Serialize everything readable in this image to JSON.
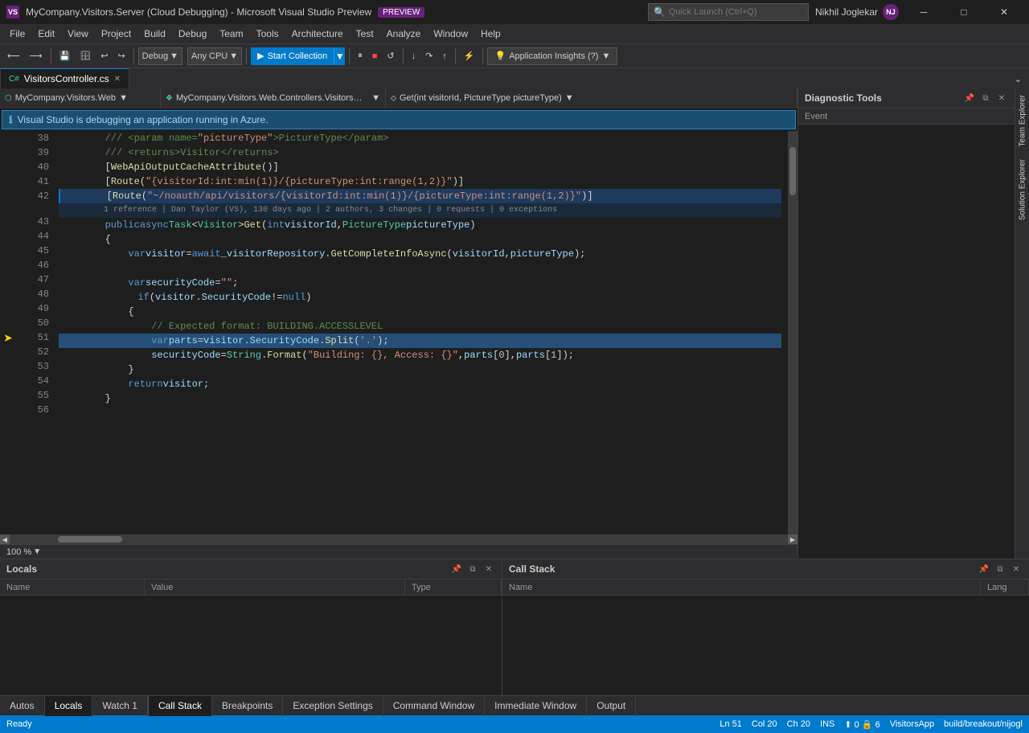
{
  "titleBar": {
    "title": "MyCompany.Visitors.Server (Cloud Debugging) - Microsoft Visual Studio Preview",
    "previewLabel": "PREVIEW",
    "searchPlaceholder": "Quick Launch (Ctrl+Q)",
    "user": "Nikhil Joglekar",
    "userInitials": "NJ"
  },
  "menuBar": {
    "items": [
      "File",
      "Edit",
      "View",
      "Project",
      "Build",
      "Debug",
      "Team",
      "Tools",
      "Architecture",
      "Test",
      "Analyze",
      "Window",
      "Help"
    ]
  },
  "toolbar": {
    "debugConfig": "Debug",
    "platform": "Any CPU",
    "startCollection": "Start Collection",
    "aiLabel": "Application Insights (?) "
  },
  "tabs": {
    "active": "VisitorsController.cs",
    "items": [
      {
        "label": "VisitorsController.cs",
        "active": true
      }
    ]
  },
  "navBar": {
    "project": "MyCompany.Visitors.Web",
    "class": "MyCompany.Visitors.Web.Controllers.VisitorsContr...",
    "method": "Get(int visitorId, PictureType pictureType)"
  },
  "infoBar": {
    "message": "Visual Studio is debugging an application running in Azure."
  },
  "code": {
    "lines": [
      {
        "num": 38,
        "content": "        /// <param name=\"pictureType\">PictureType</param>",
        "type": "normal"
      },
      {
        "num": 39,
        "content": "        /// <returns>Visitor</returns>",
        "type": "normal"
      },
      {
        "num": 40,
        "content": "        [WebApiOutputCacheAttribute()]",
        "type": "normal"
      },
      {
        "num": 41,
        "content": "        [Route(\"{visitorId:int:min(1)}/{pictureType:int:range(1,2)}\")]",
        "type": "normal"
      },
      {
        "num": 42,
        "content": "        [Route(\"~/noauth/api/visitors/{visitorId:int:min(1)}/{pictureType:int:range(1,2)}\")]",
        "type": "ref"
      },
      {
        "num": "ref",
        "content": "        1 reference | Dan Taylor (VS), 130 days ago | 2 authors, 3 changes | 0 requests | 0 exceptions",
        "type": "meta"
      },
      {
        "num": 43,
        "content": "        public async Task<Visitor> Get(int visitorId, PictureType pictureType)",
        "type": "normal"
      },
      {
        "num": 44,
        "content": "        {",
        "type": "normal"
      },
      {
        "num": 45,
        "content": "            var visitor = await _visitorRepository.GetCompleteInfoAsync(visitorId, pictureType);",
        "type": "normal"
      },
      {
        "num": 46,
        "content": "",
        "type": "normal"
      },
      {
        "num": 47,
        "content": "            var securityCode = \"\";",
        "type": "normal"
      },
      {
        "num": 48,
        "content": "            if (visitor.SecurityCode != null)",
        "type": "normal"
      },
      {
        "num": 49,
        "content": "            {",
        "type": "normal"
      },
      {
        "num": 50,
        "content": "                // Expected format: BUILDING.ACCESSLEVEL",
        "type": "normal"
      },
      {
        "num": 51,
        "content": "                var parts = visitor.SecurityCode.Split('.');",
        "type": "highlighted"
      },
      {
        "num": 52,
        "content": "                securityCode = String.Format(\"Building: {}, Access: {}\", parts[0], parts[1]);",
        "type": "normal"
      },
      {
        "num": 53,
        "content": "            }",
        "type": "normal"
      },
      {
        "num": 54,
        "content": "            return visitor;",
        "type": "normal"
      },
      {
        "num": 55,
        "content": "        }",
        "type": "normal"
      },
      {
        "num": 56,
        "content": "",
        "type": "normal"
      }
    ]
  },
  "diagnosticTools": {
    "title": "Diagnostic Tools",
    "columnLabel": "Event"
  },
  "bottomPanels": {
    "left": {
      "title": "Locals",
      "columns": [
        "Name",
        "Value",
        "Type"
      ]
    },
    "right": {
      "title": "Call Stack",
      "columns": [
        "Name",
        "Lang"
      ]
    }
  },
  "bottomTabs": {
    "left": [
      {
        "label": "Autos",
        "active": false
      },
      {
        "label": "Locals",
        "active": true
      },
      {
        "label": "Watch 1",
        "active": false
      }
    ],
    "right": [
      {
        "label": "Call Stack",
        "active": true
      },
      {
        "label": "Breakpoints",
        "active": false
      },
      {
        "label": "Exception Settings",
        "active": false
      },
      {
        "label": "Command Window",
        "active": false
      },
      {
        "label": "Immediate Window",
        "active": false
      },
      {
        "label": "Output",
        "active": false
      }
    ]
  },
  "statusBar": {
    "ready": "Ready",
    "ln": "Ln 51",
    "col": "Col 20",
    "ch": "Ch 20",
    "mode": "INS",
    "arrows": "0",
    "lock": "6",
    "app": "VisitorsApp",
    "build": "build/breakout/nijogl"
  },
  "sideTabs": [
    "Team Explorer",
    "Solution Explorer"
  ]
}
